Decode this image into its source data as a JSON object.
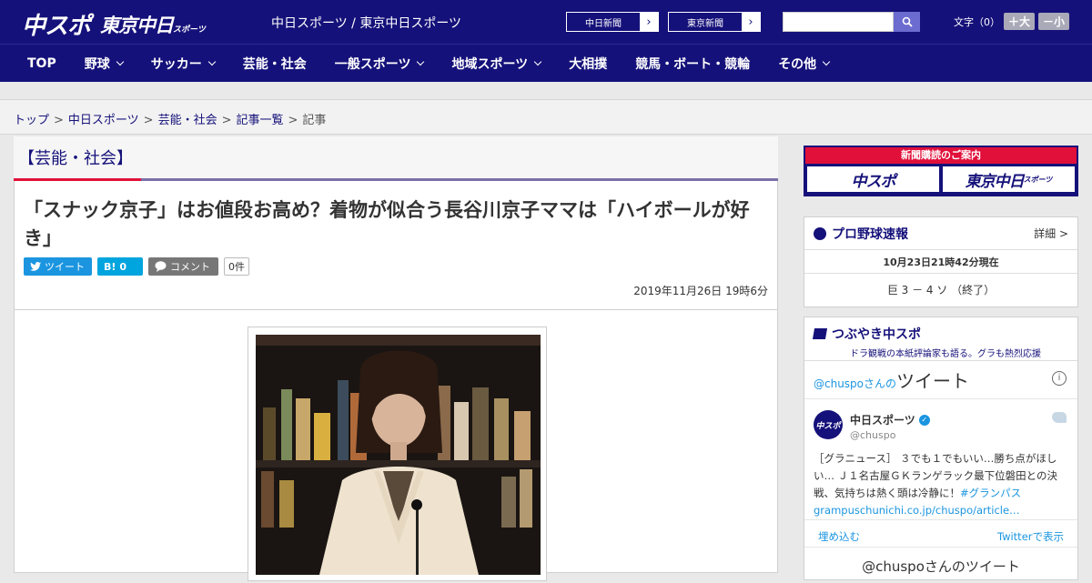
{
  "header": {
    "logo_chuspo": "中スポ",
    "logo_tokyo": "東京中日",
    "logo_tokyo_small": "スポーツ",
    "site_names": "中日スポーツ / 東京中日スポーツ",
    "news_buttons": [
      {
        "label": "中日新聞"
      },
      {
        "label": "東京新聞"
      }
    ],
    "search_placeholder": "",
    "font_size_label": "文字（0）",
    "font_plus": "＋大",
    "font_minus": "－小"
  },
  "nav": {
    "items": [
      {
        "label": "TOP",
        "dropdown": false
      },
      {
        "label": "野球",
        "dropdown": true
      },
      {
        "label": "サッカー",
        "dropdown": true
      },
      {
        "label": "芸能・社会",
        "dropdown": false
      },
      {
        "label": "一般スポーツ",
        "dropdown": true
      },
      {
        "label": "地域スポーツ",
        "dropdown": true
      },
      {
        "label": "大相撲",
        "dropdown": false
      },
      {
        "label": "競馬・ボート・競輪",
        "dropdown": false
      },
      {
        "label": "その他",
        "dropdown": true
      }
    ]
  },
  "breadcrumb": {
    "items": [
      "トップ",
      "中日スポーツ",
      "芸能・社会",
      "記事一覧"
    ],
    "current": "記事",
    "separator": ">"
  },
  "article": {
    "category": "【芸能・社会】",
    "headline": "「スナック京子」はお値段お高め？着物が似合う長谷川京子ママは「ハイボールが好き」",
    "tweet_label": "ツイート",
    "hatebu_label": "B!",
    "hatebu_count": "0",
    "comment_label": "コメント",
    "comment_count": "0件",
    "date": "2019年11月26日 19時6分"
  },
  "sidebar": {
    "subscribe_header": "新聞購読のご案内",
    "subscribe_logo1": "中スポ",
    "subscribe_logo2": "東京中日",
    "subscribe_logo2_small": "スポーツ",
    "baseball_title": "プロ野球速報",
    "baseball_detail": "詳細 >",
    "baseball_time": "10月23日21時42分現在",
    "baseball_score": "巨 3 － 4 ソ （終了）",
    "tsubuyaki_title": "つぶやき中スポ",
    "tsubuyaki_sub": "ドラ観戦の本紙評論家も語る。グラも熱烈応援",
    "tw_header_prefix": "@chuspoさんの",
    "tw_header_main": "ツイート",
    "tw_info": "i",
    "tw_avatar": "中スポ",
    "tw_name": "中日スポーツ",
    "tw_handle": "@chuspo",
    "tw_text": "［グラニュース］ ３でも１でもいい…勝ち点がほしい… Ｊ１名古屋ＧＫランゲラック最下位磐田との決戦、気持ちは熱く頭は冷静に！",
    "tw_tag": "#グランパス",
    "tw_link": "grampuschunichi.co.jp/chuspo/article…",
    "tw_embed": "埋め込む",
    "tw_view": "Twitterで表示",
    "tw_more": "@chuspoさんのツイート"
  },
  "colors": {
    "brand": "#15117a",
    "accent": "#e0103a",
    "twitter": "#1b95e0"
  }
}
